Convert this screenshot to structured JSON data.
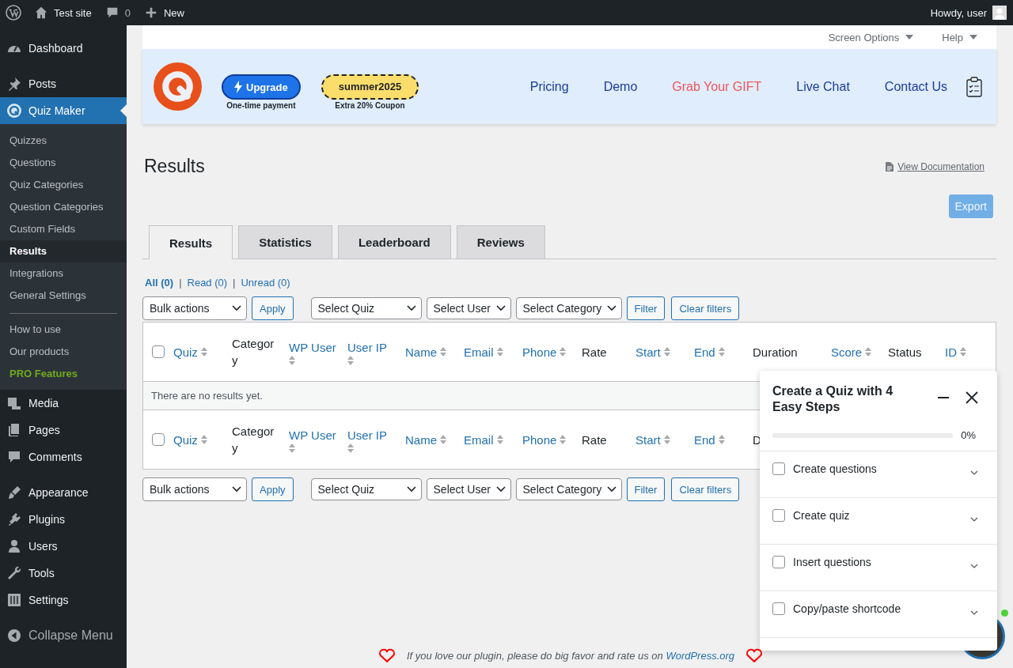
{
  "admin_bar": {
    "site": "Test site",
    "comments": "0",
    "new": "New",
    "greeting": "Howdy, user"
  },
  "sidebar": {
    "groups": [
      [
        {
          "label": "Dashboard",
          "selected": false
        }
      ],
      [
        {
          "label": "Posts",
          "selected": false
        },
        {
          "label": "Quiz Maker",
          "selected": true
        },
        {
          "label": "Media",
          "selected": false
        },
        {
          "label": "Pages",
          "selected": false
        },
        {
          "label": "Comments",
          "selected": false
        }
      ],
      [
        {
          "label": "Appearance",
          "selected": false
        },
        {
          "label": "Plugins",
          "selected": false
        },
        {
          "label": "Users",
          "selected": false
        },
        {
          "label": "Tools",
          "selected": false
        },
        {
          "label": "Settings",
          "selected": false
        }
      ]
    ],
    "submenu": [
      [
        {
          "label": "Quizzes",
          "kind": "link",
          "selected": false
        },
        {
          "label": "Questions",
          "kind": "link",
          "selected": false
        },
        {
          "label": "Quiz Categories",
          "kind": "link",
          "selected": false
        },
        {
          "label": "Question Categories",
          "kind": "link",
          "selected": false
        },
        {
          "label": "Custom Fields",
          "kind": "link",
          "selected": false
        },
        {
          "label": "Results",
          "kind": "link",
          "selected": true
        },
        {
          "label": "Integrations",
          "kind": "link",
          "selected": false
        },
        {
          "label": "General Settings",
          "kind": "link",
          "selected": false
        }
      ],
      [
        {
          "label": "How to use",
          "kind": "link",
          "selected": false
        },
        {
          "label": "Our products",
          "kind": "link",
          "selected": false
        },
        {
          "label": "PRO Features",
          "kind": "pro",
          "selected": false
        }
      ]
    ],
    "collapse": "Collapse Menu"
  },
  "screen_tabs": [
    "Screen Options",
    "Help"
  ],
  "banner": {
    "upgrade": {
      "label": "Upgrade",
      "note": "One-time payment"
    },
    "coupon": {
      "code": "summer2025",
      "note": "Extra 20% Coupon"
    },
    "links": [
      {
        "label": "Pricing",
        "highlight": false
      },
      {
        "label": "Demo",
        "highlight": false
      },
      {
        "label": "Grab Your GIFT",
        "highlight": true
      },
      {
        "label": "Live Chat",
        "highlight": false
      },
      {
        "label": "Contact Us",
        "highlight": false
      }
    ]
  },
  "page": {
    "title": "Results",
    "doc_link": "View Documentation",
    "export": "Export"
  },
  "tabs": [
    {
      "label": "Results",
      "selected": true
    },
    {
      "label": "Statistics",
      "selected": false
    },
    {
      "label": "Leaderboard",
      "selected": false
    },
    {
      "label": "Reviews",
      "selected": false
    }
  ],
  "views": {
    "separator": "|",
    "items": [
      {
        "label": "All (0)",
        "selected": true
      },
      {
        "label": "Read (0)",
        "selected": false
      },
      {
        "label": "Unread (0)",
        "selected": false
      }
    ]
  },
  "toolbars": [
    {
      "bulk": "Bulk actions",
      "apply": "Apply",
      "selects": [
        "Select Quiz",
        "Select User",
        "Select Category"
      ],
      "filter": "Filter",
      "clear": "Clear filters"
    },
    {
      "bulk": "Bulk actions",
      "apply": "Apply",
      "selects": [
        "Select Quiz",
        "Select User",
        "Select Category"
      ],
      "filter": "Filter",
      "clear": "Clear filters"
    }
  ],
  "table": {
    "header_checked": false,
    "footer_checked": false,
    "columns": [
      {
        "label": "Quiz",
        "sortable": true
      },
      {
        "label": "Category",
        "sortable": false
      },
      {
        "label": "WP User",
        "sortable": true
      },
      {
        "label": "User IP",
        "sortable": true
      },
      {
        "label": "Name",
        "sortable": true
      },
      {
        "label": "Email",
        "sortable": true
      },
      {
        "label": "Phone",
        "sortable": true
      },
      {
        "label": "Rate",
        "sortable": false
      },
      {
        "label": "Start",
        "sortable": true
      },
      {
        "label": "End",
        "sortable": true
      },
      {
        "label": "Duration",
        "sortable": false
      },
      {
        "label": "Score",
        "sortable": true
      },
      {
        "label": "Status",
        "sortable": false
      },
      {
        "label": "ID",
        "sortable": true
      }
    ],
    "empty": "There are no results yet.",
    "footer_columns": [
      {
        "label": "Quiz",
        "sortable": true
      },
      {
        "label": "Category",
        "sortable": false
      },
      {
        "label": "WP User",
        "sortable": true
      },
      {
        "label": "User IP",
        "sortable": true
      },
      {
        "label": "Name",
        "sortable": true
      },
      {
        "label": "Email",
        "sortable": true
      },
      {
        "label": "Phone",
        "sortable": true
      },
      {
        "label": "Rate",
        "sortable": false
      },
      {
        "label": "Start",
        "sortable": true
      },
      {
        "label": "End",
        "sortable": true
      },
      {
        "label": "D",
        "sortable": false
      }
    ]
  },
  "steps_panel": {
    "title": "Create a Quiz with 4 Easy Steps",
    "level": 0,
    "reading": "0%",
    "steps": [
      {
        "label": "Create questions",
        "checked": false
      },
      {
        "label": "Create quiz",
        "checked": false
      },
      {
        "label": "Insert questions",
        "checked": false
      },
      {
        "label": "Copy/paste shortcode",
        "checked": false
      }
    ]
  },
  "footer": {
    "text": "If you love our plugin, please do big favor and rate us on ",
    "link": "WordPress.org"
  }
}
